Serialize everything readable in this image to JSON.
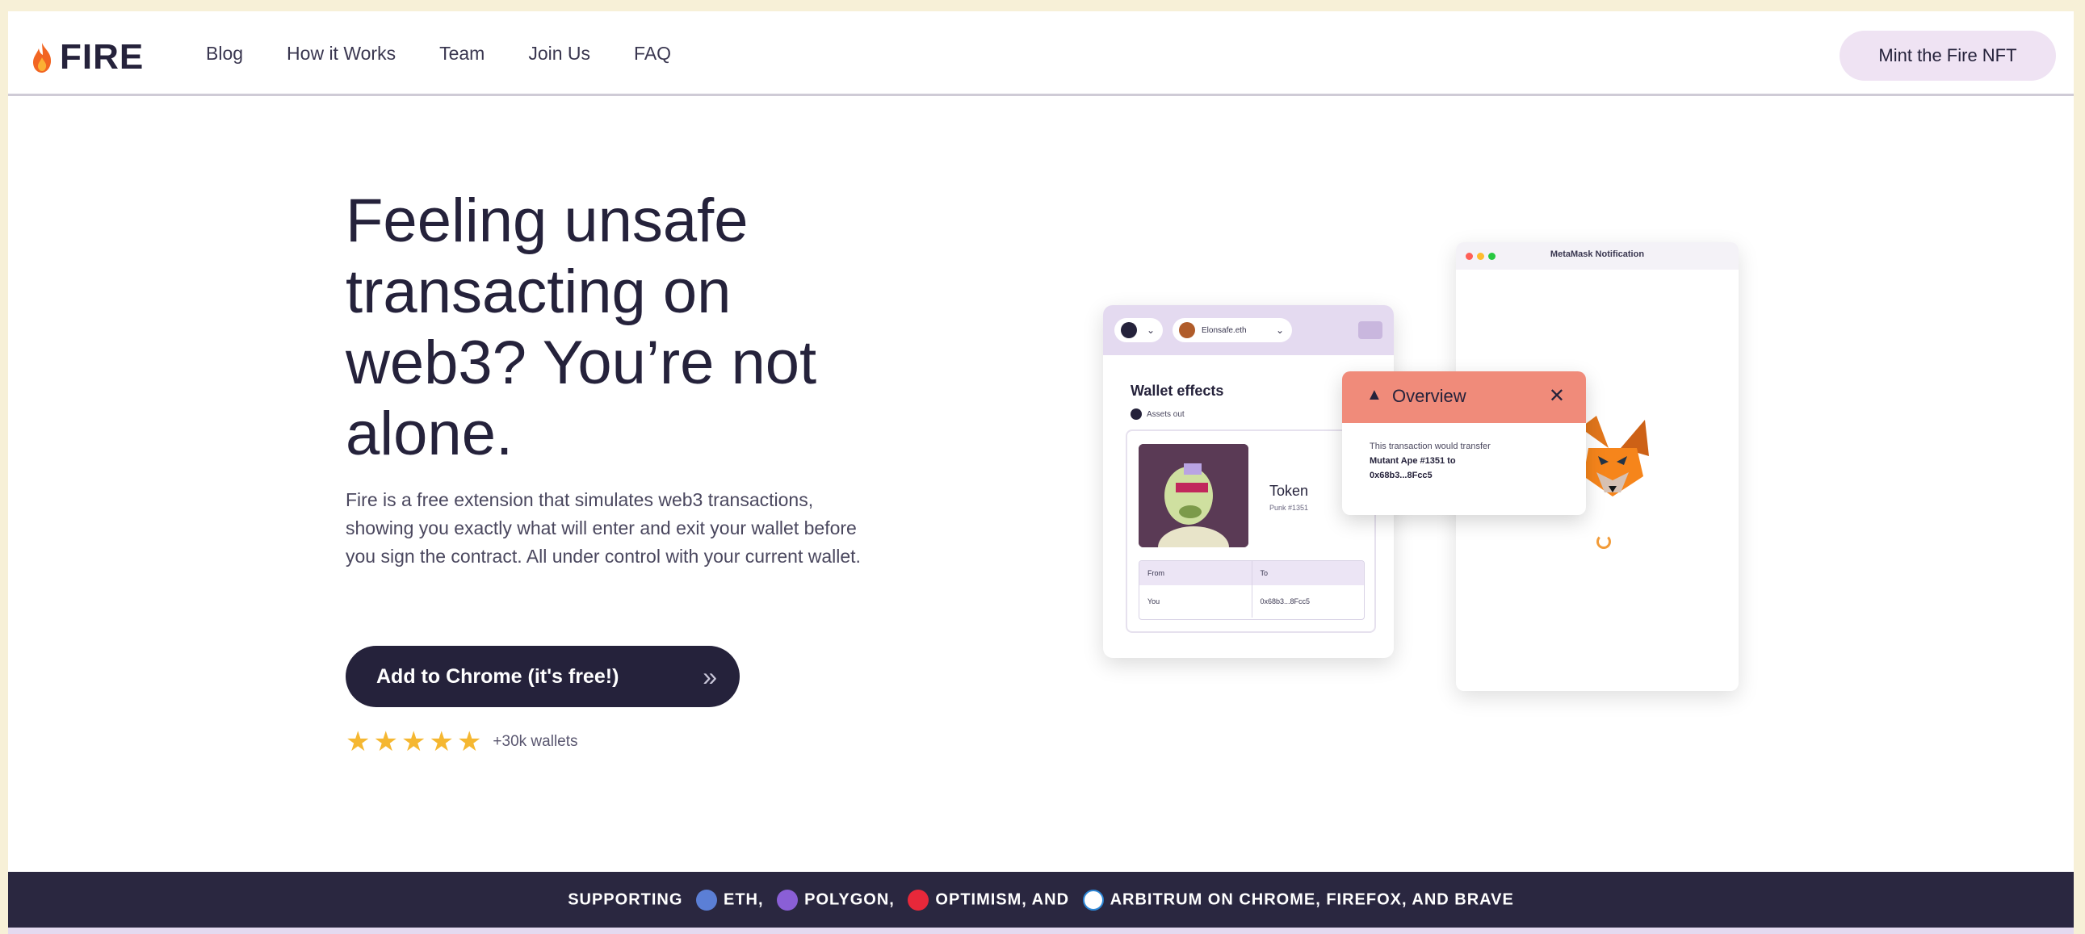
{
  "header": {
    "logo_text": "FIRE",
    "nav": [
      "Blog",
      "How it Works",
      "Team",
      "Join Us",
      "FAQ"
    ],
    "mint_button": "Mint the Fire NFT"
  },
  "hero": {
    "headline": "Feeling unsafe transacting on web3? You’re not alone.",
    "subtext": "Fire is a free extension that simulates web3 transactions, showing you exactly what will enter and exit your wallet before you sign the contract. All under control with your current wallet.",
    "cta_label": "Add to Chrome (it's free!)",
    "cta_chevron": "»",
    "rating": {
      "stars": 5,
      "text": "+30k wallets"
    }
  },
  "illustration": {
    "notification_window_title": "MetaMask Notification",
    "extension": {
      "account_label": "Elonsafe.eth",
      "wallet_effects_title": "Wallet effects",
      "assets_out_label": "Assets out",
      "token_name": "Token",
      "token_sub": "Punk #1351",
      "table_headers": [
        "From",
        "To"
      ],
      "table_row": [
        "You",
        "0x68b3...8Fcc5"
      ]
    },
    "overview": {
      "title": "Overview",
      "close": "✕",
      "text_line": "This transaction would transfer",
      "text_bold_1": "Mutant Ape #1351 to",
      "text_bold_2": "0x68b3...8Fcc5"
    }
  },
  "band": {
    "part1": "SUPPORTING",
    "eth": "ETH,",
    "polygon": "POLYGON,",
    "optimism": "OPTIMISM, AND",
    "arbitrum": "ARBITRUM ON CHROME, FIREFOX, AND BRAVE"
  },
  "colors": {
    "dark": "#25223b",
    "band": "#2a2740",
    "mint_bg": "#efe3f3",
    "overview_header": "#f08b7a",
    "page_bg": "#f7f0d7"
  }
}
